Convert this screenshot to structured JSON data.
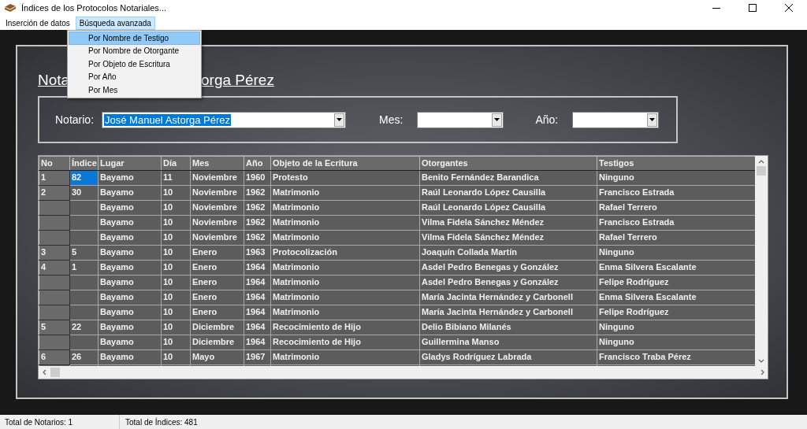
{
  "window": {
    "title": "Índices de los Protocolos Notariales..."
  },
  "menu": [
    {
      "label": "Inserción de datos",
      "selected": false
    },
    {
      "label": "Búsqueda avanzada",
      "selected": true
    }
  ],
  "dropdown": [
    {
      "label": "Por Nombre de Testigo",
      "selected": true
    },
    {
      "label": "Por Nombre de Otorgante",
      "selected": false
    },
    {
      "label": "Por Objeto de Escritura",
      "selected": false
    },
    {
      "label": "Por Año",
      "selected": false
    },
    {
      "label": "Por Mes",
      "selected": false
    }
  ],
  "heading_parts": [
    "Nota",
    "orga Pérez"
  ],
  "filters": [
    {
      "label": "Notario:",
      "value": "José Manuel Astorga Pérez",
      "highlighted": true,
      "kind": "wide"
    },
    {
      "label": "Mes:",
      "kind": "narrow"
    },
    {
      "label": "Año:",
      "kind": "narrow"
    }
  ],
  "table": {
    "columns": [
      "No",
      "Índice",
      "Lugar",
      "Día",
      "Mes",
      "Año",
      "Objeto de la Ecritura",
      "Otorgantes",
      "Testigos"
    ],
    "rows": [
      {
        "no": "1",
        "indice": "82",
        "indice_selected": true,
        "lugar": "Bayamo",
        "dia": "11",
        "mes": "Noviembre",
        "anio": "1960",
        "objeto": "Protesto",
        "otorgantes": "Benito Fernández Barandica",
        "testigos": "Ninguno"
      },
      {
        "no": "2",
        "indice": "30",
        "indice_selected": false,
        "lugar": "Bayamo",
        "dia": "10",
        "mes": "Noviembre",
        "anio": "1962",
        "objeto": "Matrimonio",
        "otorgantes": "Raúl Leonardo López Causilla",
        "testigos": "Francisco Estrada"
      },
      {
        "indice_selected": false,
        "lugar": "Bayamo",
        "dia": "10",
        "mes": "Noviembre",
        "anio": "1962",
        "objeto": "Matrimonio",
        "otorgantes": "Raúl Leonardo López Causilla",
        "testigos": "Rafael Terrero"
      },
      {
        "indice_selected": false,
        "lugar": "Bayamo",
        "dia": "10",
        "mes": "Noviembre",
        "anio": "1962",
        "objeto": "Matrimonio",
        "otorgantes": "Vilma Fidela Sánchez Méndez",
        "testigos": "Francisco Estrada"
      },
      {
        "indice_selected": false,
        "lugar": "Bayamo",
        "dia": "10",
        "mes": "Noviembre",
        "anio": "1962",
        "objeto": "Matrimonio",
        "otorgantes": "Vilma Fidela Sánchez Méndez",
        "testigos": "Rafael Terrero"
      },
      {
        "no": "3",
        "indice": "5",
        "indice_selected": false,
        "lugar": "Bayamo",
        "dia": "10",
        "mes": "Enero",
        "anio": "1963",
        "objeto": "Protocolización",
        "otorgantes": "Joaquín Collada Martín",
        "testigos": "Ninguno"
      },
      {
        "no": "4",
        "indice": "1",
        "indice_selected": false,
        "lugar": "Bayamo",
        "dia": "10",
        "mes": "Enero",
        "anio": "1964",
        "objeto": "Matrimonio",
        "otorgantes": "Asdel Pedro Benegas y González",
        "testigos": "Enma Silvera Escalante"
      },
      {
        "indice_selected": false,
        "lugar": "Bayamo",
        "dia": "10",
        "mes": "Enero",
        "anio": "1964",
        "objeto": "Matrimonio",
        "otorgantes": "Asdel Pedro Benegas y González",
        "testigos": "Felipe Rodríguez"
      },
      {
        "indice_selected": false,
        "lugar": "Bayamo",
        "dia": "10",
        "mes": "Enero",
        "anio": "1964",
        "objeto": "Matrimonio",
        "otorgantes": "María Jacinta Hernández y Carbonell",
        "testigos": "Enma Silvera Escalante"
      },
      {
        "indice_selected": false,
        "lugar": "Bayamo",
        "dia": "10",
        "mes": "Enero",
        "anio": "1964",
        "objeto": "Matrimonio",
        "otorgantes": "María Jacinta Hernández y Carbonell",
        "testigos": "Felipe Rodríguez"
      },
      {
        "no": "5",
        "indice": "22",
        "indice_selected": false,
        "lugar": "Bayamo",
        "dia": "10",
        "mes": "Diciembre",
        "anio": "1964",
        "objeto": "Recocimiento de Hijo",
        "otorgantes": "Delio Bibiano Milanés",
        "testigos": "Ninguno"
      },
      {
        "indice_selected": false,
        "lugar": "Bayamo",
        "dia": "10",
        "mes": "Diciembre",
        "anio": "1964",
        "objeto": "Recocimiento de Hijo",
        "otorgantes": "Guillermina Manso",
        "testigos": "Ninguno"
      },
      {
        "no": "6",
        "indice": "26",
        "indice_selected": false,
        "lugar": "Bayamo",
        "dia": "10",
        "mes": "Mayo",
        "anio": "1967",
        "objeto": "Matrimonio",
        "otorgantes": "Gladys Rodríguez Labrada",
        "testigos": "Francisco Traba Pérez"
      }
    ]
  },
  "status_bar": [
    "Total de Notarios: 1",
    "Total de Índices: 481"
  ]
}
